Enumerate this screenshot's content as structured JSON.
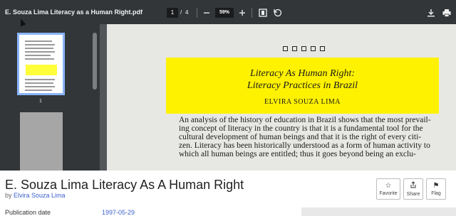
{
  "toolbar": {
    "doc_title": "E. Souza Lima Literacy as a Human Right.pdf",
    "current_page": "1",
    "page_separator": "/",
    "total_pages": "4",
    "zoom": "59%",
    "icons": [
      "minus-icon",
      "plus-icon",
      "fit-page-icon",
      "rotate-icon",
      "download-icon",
      "print-icon"
    ]
  },
  "sidebar": {
    "thumbnails": [
      {
        "label": "1",
        "selected": true
      },
      {
        "label": "",
        "selected": false
      }
    ]
  },
  "page": {
    "title_line1": "Literacy As Human Right:",
    "title_line2": "Literacy Practices in Brazil",
    "author": "ELVIRA SOUZA LIMA",
    "body_lines": [
      "An analysis of the history of education in Brazil shows that the most prevail-",
      "ing concept of literacy in the country is that it is a fundamental tool for the",
      "cultural development of human beings and that it is the right of every citi-",
      "zen. Literacy has been historically understood as a form of human activity to",
      "which all human beings are entitled; thus it goes beyond being an exclu-"
    ],
    "highlight_color": "#fff200"
  },
  "meta": {
    "title": "E. Souza Lima Literacy As A Human Right",
    "by_prefix": "by",
    "author": "Elvira Souza Lima",
    "publication_date_label": "Publication date",
    "publication_date": "1997-05-29",
    "actions": [
      {
        "label": "Favorite",
        "icon": "star-icon"
      },
      {
        "label": "Share",
        "icon": "share-icon"
      },
      {
        "label": "Flag",
        "icon": "flag-icon"
      }
    ]
  }
}
